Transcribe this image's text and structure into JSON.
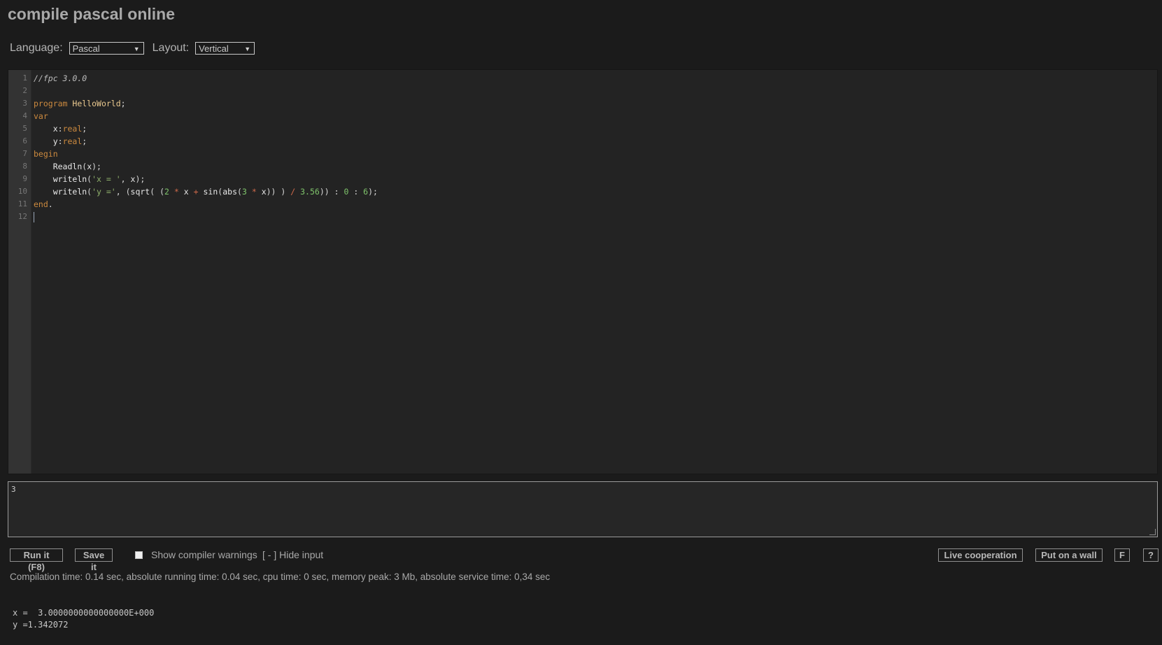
{
  "header": {
    "title": "compile pascal online"
  },
  "selectors": {
    "language_label": "Language:",
    "language_value": "Pascal",
    "layout_label": "Layout:",
    "layout_value": "Vertical"
  },
  "editor": {
    "line_numbers": [
      "1",
      "2",
      "3",
      "4",
      "5",
      "6",
      "7",
      "8",
      "9",
      "10",
      "11",
      "12"
    ],
    "code_lines": [
      "//fpc 3.0.0",
      "",
      "program HelloWorld;",
      "var",
      "    x:real;",
      "    y:real;",
      "begin",
      "    Readln(x);",
      "    writeln('x = ', x);",
      "    writeln('y =', (sqrt( (2 * x + sin(abs(3 * x)) ) / 3.56)) : 0 : 6);",
      "end.",
      ""
    ]
  },
  "input": {
    "value": "3"
  },
  "toolbar": {
    "run_label": "Run it (F8)",
    "save_label": "Save it",
    "warnings_label": "Show compiler warnings",
    "hide_input_label": "[ - ] Hide input",
    "live_coop_label": "Live cooperation",
    "wall_label": "Put on a wall",
    "f_label": "F",
    "help_label": "?"
  },
  "stats": {
    "text": "Compilation time: 0.14 sec, absolute running time: 0.04 sec, cpu time: 0 sec, memory peak: 3 Mb, absolute service time: 0,34 sec"
  },
  "output": {
    "lines": [
      "x =  3.0000000000000000E+000",
      "y =1.342072"
    ]
  },
  "icons": {
    "dropdown_arrow": "chevron-down-icon",
    "resize": "resize-grip-icon",
    "checkbox": "checkbox-icon"
  }
}
